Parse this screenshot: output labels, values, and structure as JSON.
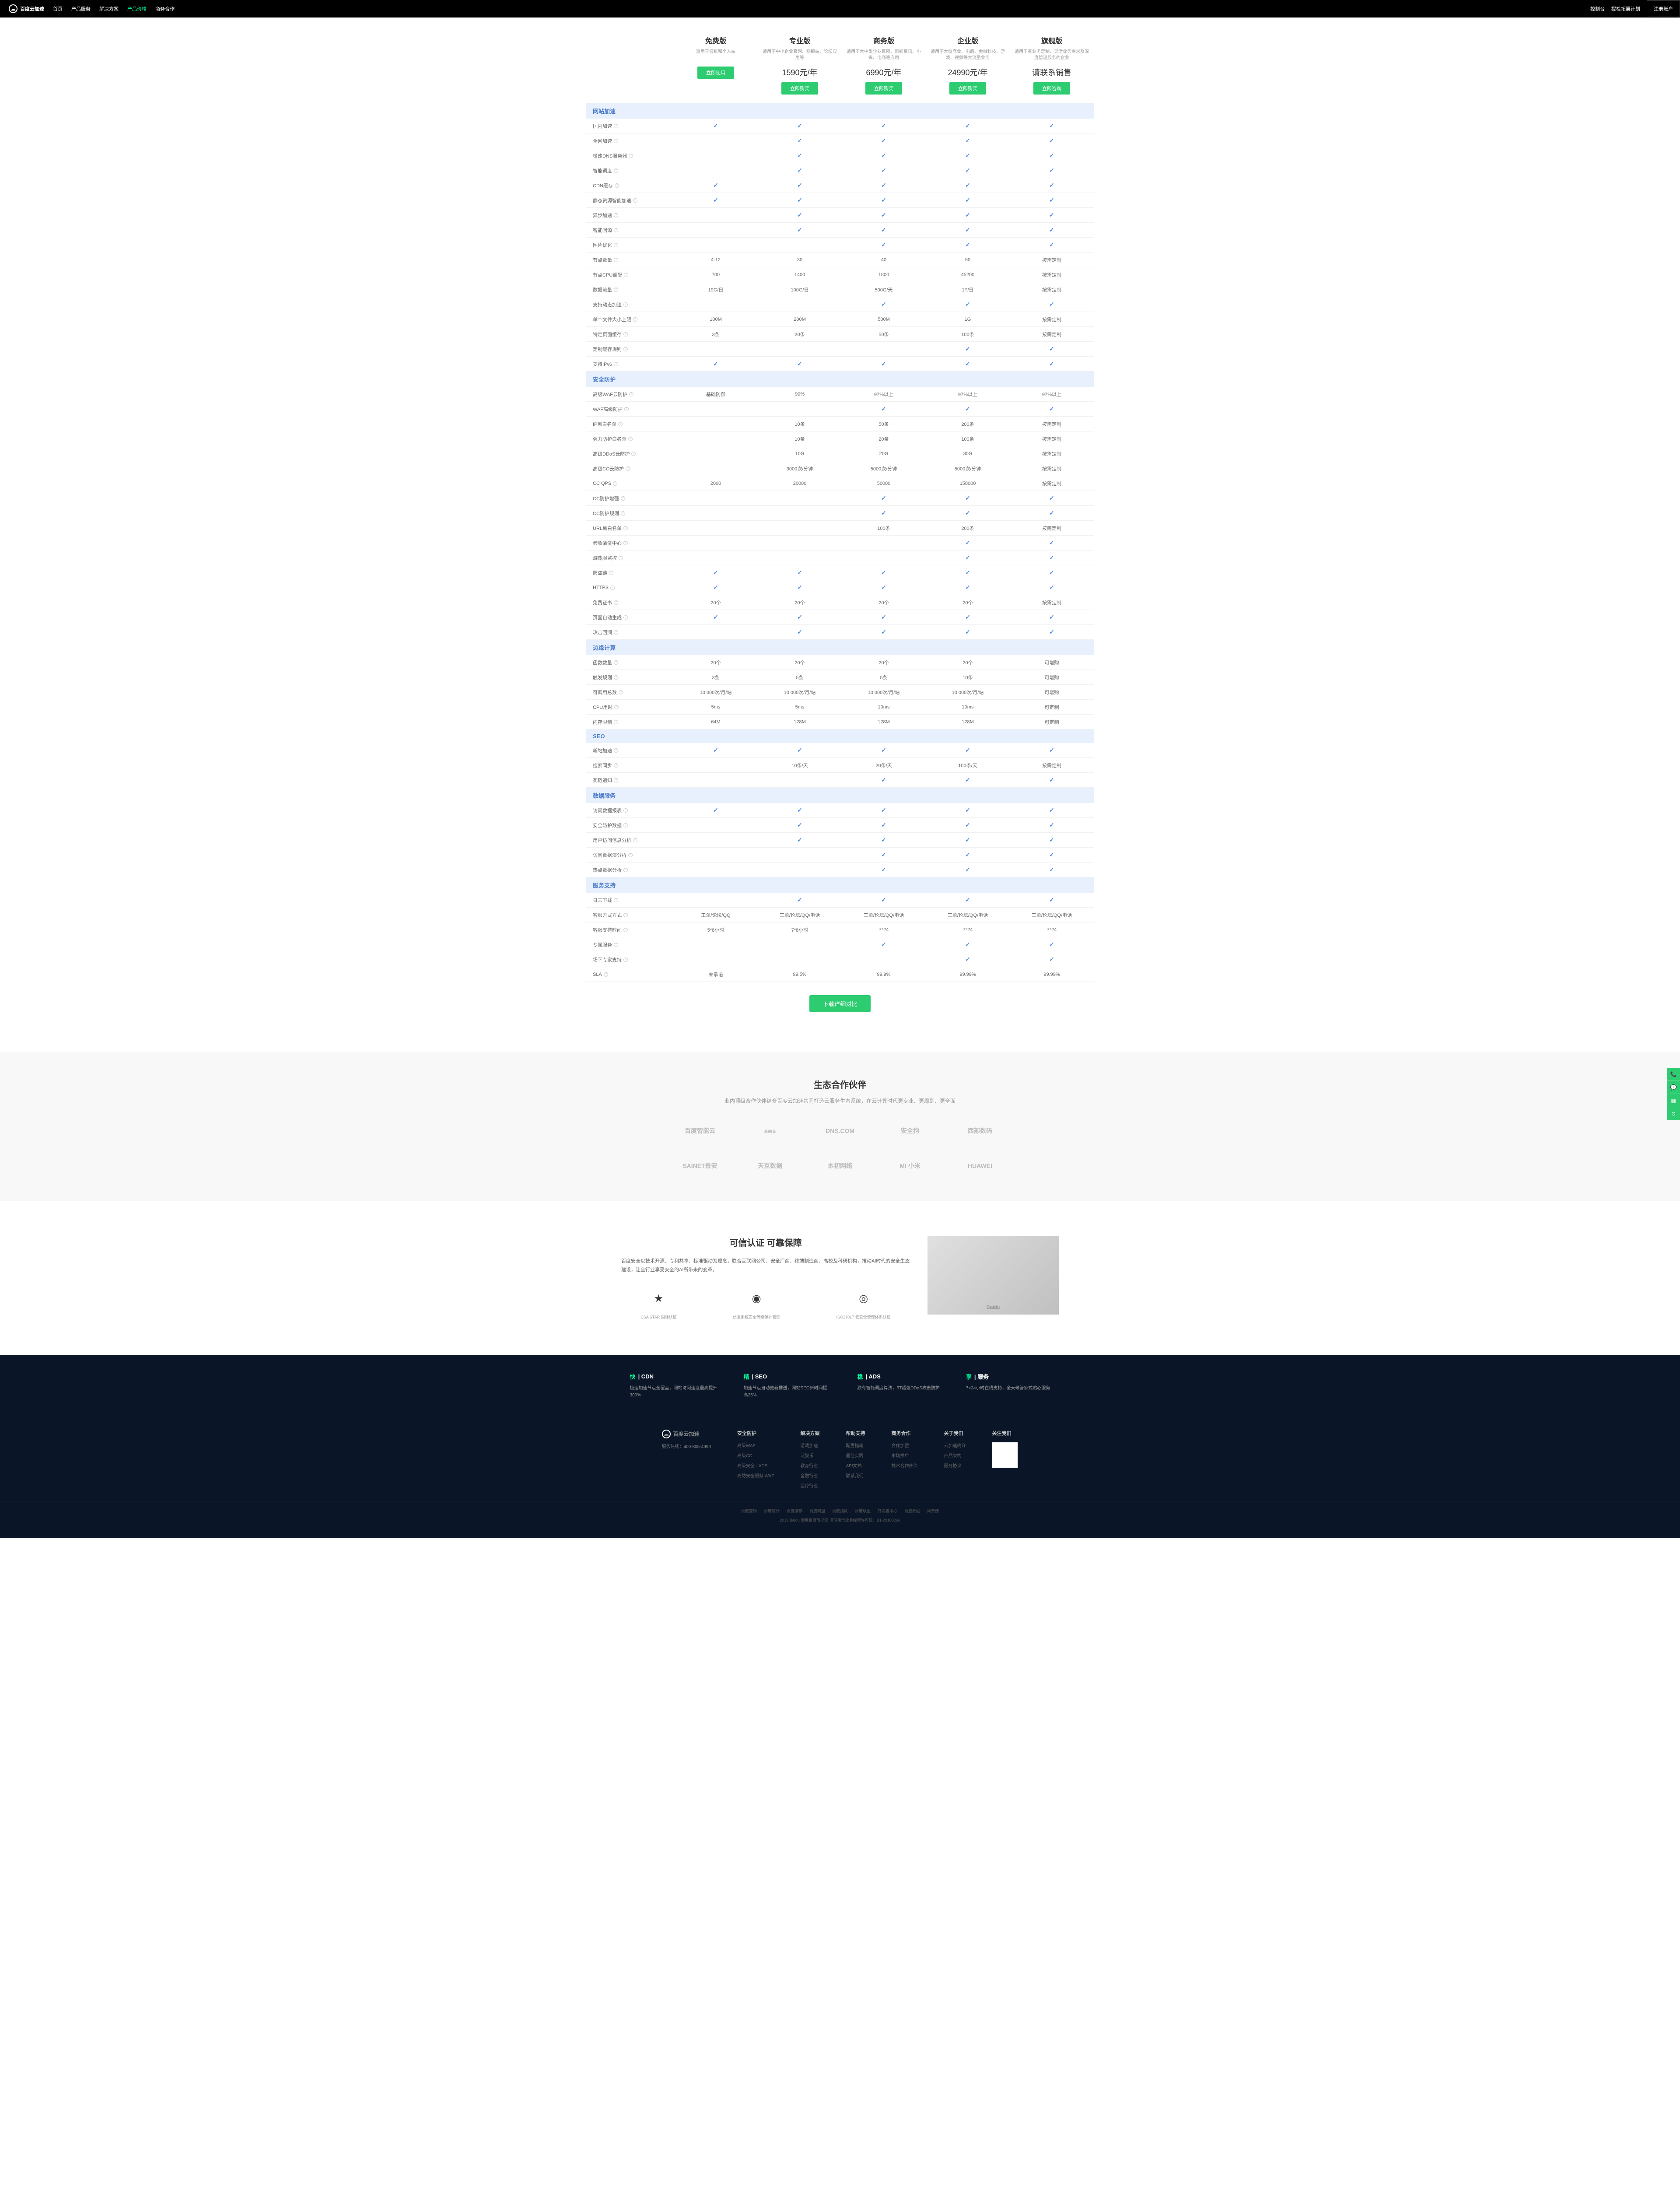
{
  "nav": {
    "logo": "百度云加速",
    "items": [
      "首页",
      "产品服务",
      "解决方案",
      "产品价格",
      "商务合作"
    ],
    "right": [
      "控制台",
      "提检拓展计划",
      "注册账户"
    ]
  },
  "plans": [
    {
      "name": "免费版",
      "desc": "适用于尝鲜和个人站",
      "price": "",
      "btn": "立即使用"
    },
    {
      "name": "专业版",
      "desc": "适用于中小企业官网、图解站、论坛应用等",
      "price": "1590元/年",
      "btn": "立即购买"
    },
    {
      "name": "商务版",
      "desc": "适用于大中型企业官网、新闻资讯、小说、电商等应用",
      "price": "6990元/年",
      "btn": "立即购买"
    },
    {
      "name": "企业版",
      "desc": "适用于大型商业、电商、金融科技、游戏、视频等大流量业务",
      "price": "24990元/年",
      "btn": "立即购买"
    },
    {
      "name": "旗舰版",
      "desc": "适用于有业务定制、灵活业务需求及深度管理服务的企业",
      "price": "请联系销售",
      "btn": "立即咨询"
    }
  ],
  "sections": [
    {
      "title": "网站加速",
      "rows": [
        {
          "label": "国内加速",
          "v": [
            "✓",
            "✓",
            "✓",
            "✓",
            "✓"
          ]
        },
        {
          "label": "全网加速",
          "v": [
            "",
            "✓",
            "✓",
            "✓",
            "✓"
          ]
        },
        {
          "label": "极速DNS服务器",
          "v": [
            "",
            "✓",
            "✓",
            "✓",
            "✓"
          ]
        },
        {
          "label": "智能调度",
          "v": [
            "",
            "✓",
            "✓",
            "✓",
            "✓"
          ]
        },
        {
          "label": "CDN缓存",
          "v": [
            "✓",
            "✓",
            "✓",
            "✓",
            "✓"
          ]
        },
        {
          "label": "静态资源智能加速",
          "v": [
            "✓",
            "✓",
            "✓",
            "✓",
            "✓"
          ]
        },
        {
          "label": "异步加速",
          "v": [
            "",
            "✓",
            "✓",
            "✓",
            "✓"
          ]
        },
        {
          "label": "智能回源",
          "v": [
            "",
            "✓",
            "✓",
            "✓",
            "✓"
          ]
        },
        {
          "label": "图片优化",
          "v": [
            "",
            "",
            "✓",
            "✓",
            "✓"
          ]
        },
        {
          "label": "节点数量",
          "v": [
            "4-12",
            "30",
            "40",
            "50",
            "按需定制"
          ]
        },
        {
          "label": "节点CPU调配",
          "v": [
            "700",
            "1400",
            "1800",
            "45200",
            "按需定制"
          ]
        },
        {
          "label": "数据流量",
          "v": [
            "19G/日",
            "100G/日",
            "500G/天",
            "1T/日",
            "按需定制"
          ]
        },
        {
          "label": "支持动态加速",
          "v": [
            "",
            "",
            "✓",
            "✓",
            "✓"
          ]
        },
        {
          "label": "单个文件大小上限",
          "v": [
            "100M",
            "200M",
            "500M",
            "1G",
            "按需定制"
          ]
        },
        {
          "label": "特定页面缓存",
          "v": [
            "3条",
            "20条",
            "50条",
            "100条",
            "按需定制"
          ]
        },
        {
          "label": "定制缓存规则",
          "v": [
            "",
            "",
            "",
            "✓",
            "✓"
          ]
        },
        {
          "label": "支持IPv6",
          "v": [
            "✓",
            "✓",
            "✓",
            "✓",
            "✓"
          ]
        }
      ]
    },
    {
      "title": "安全防护",
      "rows": [
        {
          "label": "高级WAF云防护",
          "v": [
            "基础防御",
            "90%",
            "97%以上",
            "97%以上",
            "97%以上"
          ]
        },
        {
          "label": "WAF高级防护",
          "v": [
            "",
            "",
            "✓",
            "✓",
            "✓"
          ]
        },
        {
          "label": "IP黑白名单",
          "v": [
            "",
            "10条",
            "50条",
            "200条",
            "按需定制"
          ]
        },
        {
          "label": "强力防护白名单",
          "v": [
            "",
            "10条",
            "20条",
            "100条",
            "按需定制"
          ]
        },
        {
          "label": "高级DDoS云防护",
          "v": [
            "",
            "10G",
            "20G",
            "30G",
            "按需定制"
          ]
        },
        {
          "label": "高级CC云防护",
          "v": [
            "",
            "3000次/分钟",
            "5000次/分钟",
            "5000次/分钟",
            "按需定制"
          ]
        },
        {
          "label": "CC QPS",
          "v": [
            "2000",
            "20000",
            "50000",
            "150000",
            "按需定制"
          ]
        },
        {
          "label": "CC防护增强",
          "v": [
            "",
            "",
            "✓",
            "✓",
            "✓"
          ]
        },
        {
          "label": "CC防护规则",
          "v": [
            "",
            "",
            "✓",
            "✓",
            "✓"
          ]
        },
        {
          "label": "URL黑白名单",
          "v": [
            "",
            "",
            "100条",
            "200条",
            "按需定制"
          ]
        },
        {
          "label": "验收清洗中心",
          "v": [
            "",
            "",
            "",
            "✓",
            "✓"
          ]
        },
        {
          "label": "游戏服监控",
          "v": [
            "",
            "",
            "",
            "✓",
            "✓"
          ]
        },
        {
          "label": "防盗链",
          "v": [
            "✓",
            "✓",
            "✓",
            "✓",
            "✓"
          ]
        },
        {
          "label": "HTTPS",
          "v": [
            "✓",
            "✓",
            "✓",
            "✓",
            "✓"
          ]
        },
        {
          "label": "免费证书",
          "v": [
            "20个",
            "20个",
            "20个",
            "20个",
            "按需定制"
          ]
        },
        {
          "label": "页面自动生成",
          "v": [
            "✓",
            "✓",
            "✓",
            "✓",
            "✓"
          ]
        },
        {
          "label": "攻击回溯",
          "v": [
            "",
            "✓",
            "✓",
            "✓",
            "✓"
          ]
        }
      ]
    },
    {
      "title": "边缘计算",
      "rows": [
        {
          "label": "函数数量",
          "v": [
            "20个",
            "20个",
            "20个",
            "20个",
            "可增购"
          ]
        },
        {
          "label": "触发规则",
          "v": [
            "3条",
            "5条",
            "5条",
            "10条",
            "可增购"
          ]
        },
        {
          "label": "可调用总数",
          "v": [
            "10 000次/月/站",
            "10 000次/月/站",
            "10 000次/月/站",
            "10 000次/月/站",
            "可增购"
          ]
        },
        {
          "label": "CPU用时",
          "v": [
            "5ms",
            "5ms",
            "10ms",
            "10ms",
            "可定制"
          ]
        },
        {
          "label": "内存限制",
          "v": [
            "64M",
            "128M",
            "128M",
            "128M",
            "可定制"
          ]
        }
      ]
    },
    {
      "title": "SEO",
      "rows": [
        {
          "label": "新站加速",
          "v": [
            "✓",
            "✓",
            "✓",
            "✓",
            "✓"
          ]
        },
        {
          "label": "搜索同步",
          "v": [
            "",
            "10条/天",
            "20条/天",
            "100条/天",
            "按需定制"
          ]
        },
        {
          "label": "死链通知",
          "v": [
            "",
            "",
            "✓",
            "✓",
            "✓"
          ]
        }
      ]
    },
    {
      "title": "数据服务",
      "rows": [
        {
          "label": "访问数据报表",
          "v": [
            "✓",
            "✓",
            "✓",
            "✓",
            "✓"
          ]
        },
        {
          "label": "安全防护数据",
          "v": [
            "",
            "✓",
            "✓",
            "✓",
            "✓"
          ]
        },
        {
          "label": "用户访问信息分析",
          "v": [
            "",
            "✓",
            "✓",
            "✓",
            "✓"
          ]
        },
        {
          "label": "访问数据演分析",
          "v": [
            "",
            "",
            "✓",
            "✓",
            "✓"
          ]
        },
        {
          "label": "热点数据分析",
          "v": [
            "",
            "",
            "✓",
            "✓",
            "✓"
          ]
        }
      ]
    },
    {
      "title": "服务支持",
      "rows": [
        {
          "label": "日志下载",
          "v": [
            "",
            "✓",
            "✓",
            "✓",
            "✓"
          ]
        },
        {
          "label": "客服方式方式",
          "v": [
            "工单/论坛/QQ",
            "工单/论坛/QQ/电话",
            "工单/论坛/QQ/电话",
            "工单/论坛/QQ/电话",
            "工单/论坛/QQ/电话"
          ]
        },
        {
          "label": "客服支持时间",
          "v": [
            "5*8小时",
            "7*8小时",
            "7*24",
            "7*24",
            "7*24"
          ]
        },
        {
          "label": "专属服务",
          "v": [
            "",
            "",
            "✓",
            "✓",
            "✓"
          ]
        },
        {
          "label": "场下专家支持",
          "v": [
            "",
            "",
            "",
            "✓",
            "✓"
          ]
        },
        {
          "label": "SLA",
          "v": [
            "未承诺",
            "99.5%",
            "99.9%",
            "99.99%",
            "99.99%"
          ]
        }
      ]
    }
  ],
  "downloadBtn": "下载详细对比",
  "partners": {
    "title": "生态合作伙伴",
    "sub": "业内顶级合作伙伴结合百度云加速共同打造云服务生态系统，在云计算时代更专业、更周到、更全面",
    "logos": [
      "百度智能云",
      "aws",
      "DNS.COM",
      "安全狗",
      "西部数码",
      "SAINET景安",
      "天互数据",
      "本初网络",
      "MI 小米",
      "HUAWEI"
    ]
  },
  "cert": {
    "title": "可信认证 可靠保障",
    "text": "百度安全以技术开源、专利共享、标准驱动为理念，联合互联网公司、安全厂商、终端制造商、高校及科研机构，推动AI时代的安全生态建设，让全行业享受安全的AI所带来的变革。",
    "badges": [
      {
        "icon": "★",
        "text": "CSA STAR 国际认证"
      },
      {
        "icon": "◉",
        "text": "信息系统安全等级保护管理"
      },
      {
        "icon": "◎",
        "text": "ISO27017 云安全管理体系认证"
      }
    ]
  },
  "footerCards": [
    {
      "accent": "快",
      "title": "CDN",
      "text": "极速加速节点全覆盖，网站访问速度最高提升300%"
    },
    {
      "accent": "精",
      "title": "SEO",
      "text": "加速节点自动更新推送，网站SEO新时间提高25%"
    },
    {
      "accent": "稳",
      "title": "ADS",
      "text": "独有智能调度算法，5T超强DDoS攻击防护"
    },
    {
      "accent": "享",
      "title": "服务",
      "text": "7×24小时在线支持，全天候管家式贴心服务"
    }
  ],
  "footerCols": [
    {
      "title": "安全防护",
      "links": [
        "高级WAF",
        "高级CC",
        "高级安全 - ADS",
        "高防安全服务 WAF"
      ]
    },
    {
      "title": "解决方案",
      "links": [
        "游戏加速",
        "泛娱乐",
        "教育行业",
        "金融行业",
        "医疗行业"
      ]
    },
    {
      "title": "帮助支持",
      "links": [
        "配置指南",
        "最佳实践",
        "API文档",
        "联系我们"
      ]
    },
    {
      "title": "商务合作",
      "links": [
        "合作加盟",
        "市场推广",
        "技术合作伙伴"
      ]
    },
    {
      "title": "关于我们",
      "links": [
        "云加速简介",
        "产品架构",
        "服务协议"
      ]
    }
  ],
  "footerLogo": {
    "brand": "百度云加速",
    "hotline": "服务热线：400-805-4999",
    "follow": "关注我们"
  },
  "footerBottom": {
    "links": [
      "百度营销",
      "百度统计",
      "百度推荐",
      "百度网盟",
      "百度指数",
      "百度联盟",
      "开发者中心",
      "百度数据",
      "风云榜"
    ],
    "copy": "2019 Baidu 使用百度前必读 增值电信业务经营许可证：B1-20100266"
  }
}
